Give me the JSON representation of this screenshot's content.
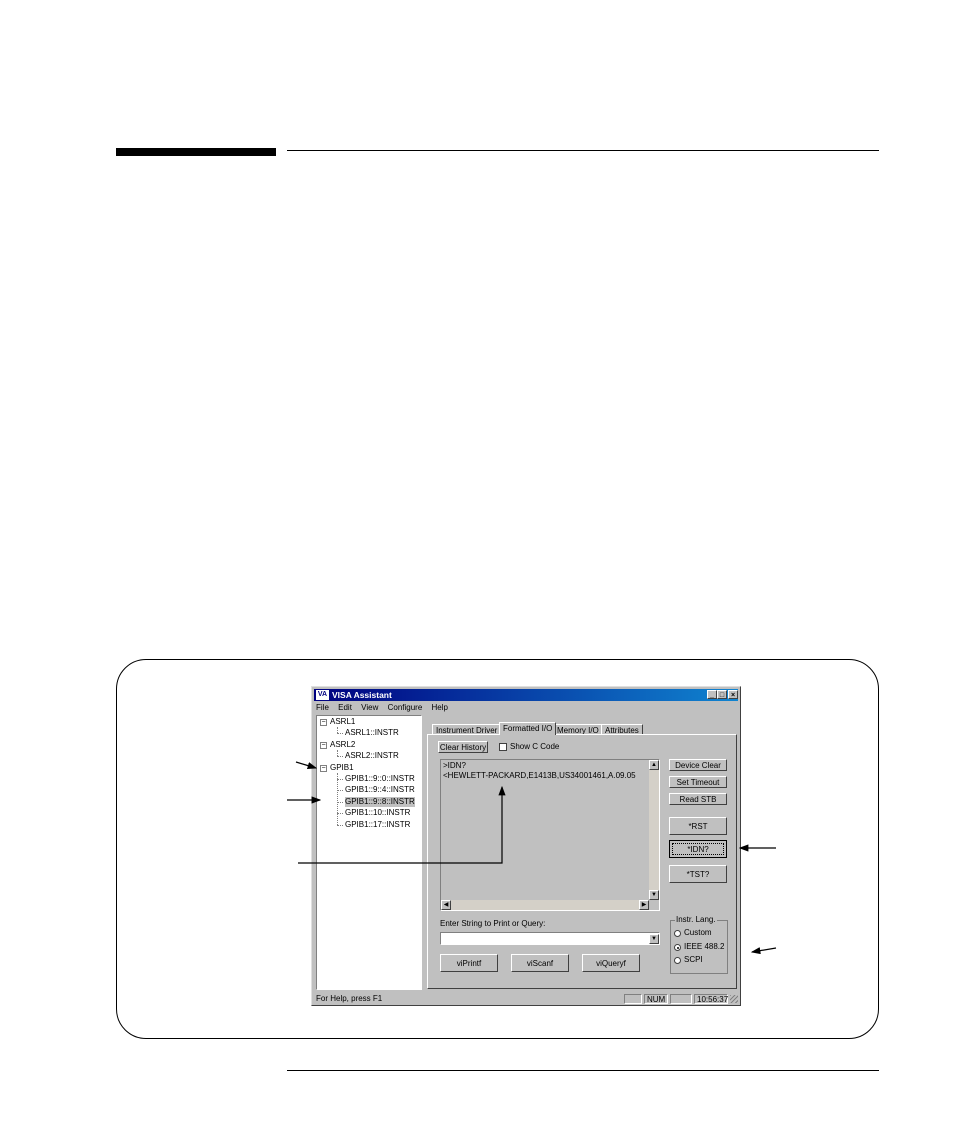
{
  "window": {
    "title": "VISA Assistant",
    "icon_label": "VA",
    "minimize": "_",
    "maximize": "□",
    "close": "×"
  },
  "menu": [
    "File",
    "Edit",
    "View",
    "Configure",
    "Help"
  ],
  "tree": {
    "asrl1": "ASRL1",
    "asrl1_instr": "ASRL1::INSTR",
    "asrl2": "ASRL2",
    "asrl2_instr": "ASRL2::INSTR",
    "gpib1": "GPIB1",
    "gpib_items": [
      "GPIB1::9::0::INSTR",
      "GPIB1::9::4::INSTR",
      "GPIB1::9::8::INSTR",
      "GPIB1::10::INSTR",
      "GPIB1::17::INSTR"
    ],
    "expand_symbol": "−"
  },
  "tabs": [
    "Instrument Driver",
    "Formatted I/O",
    "Memory I/O",
    "Attributes"
  ],
  "formatted_io": {
    "clear_history": "Clear History",
    "show_c_code": "Show C Code",
    "output_lines": [
      ">IDN?",
      "<HEWLETT-PACKARD,E1413B,US34001461,A.09.05"
    ],
    "device_clear": "Device Clear",
    "set_timeout": "Set Timeout",
    "read_stb": "Read STB",
    "rst": "*RST",
    "idn": "*IDN?",
    "tst": "*TST?",
    "enter_label": "Enter String to Print or Query:",
    "input_value": "",
    "viprintf": "viPrintf",
    "viscanf": "viScanf",
    "viqueryf": "viQueryf",
    "lang_group": "Instr. Lang.",
    "lang_options": [
      "Custom",
      "IEEE 488.2",
      "SCPI"
    ],
    "lang_selected": "IEEE 488.2"
  },
  "status": {
    "help": "For Help, press F1",
    "num": "NUM",
    "time": "10:56:37"
  }
}
